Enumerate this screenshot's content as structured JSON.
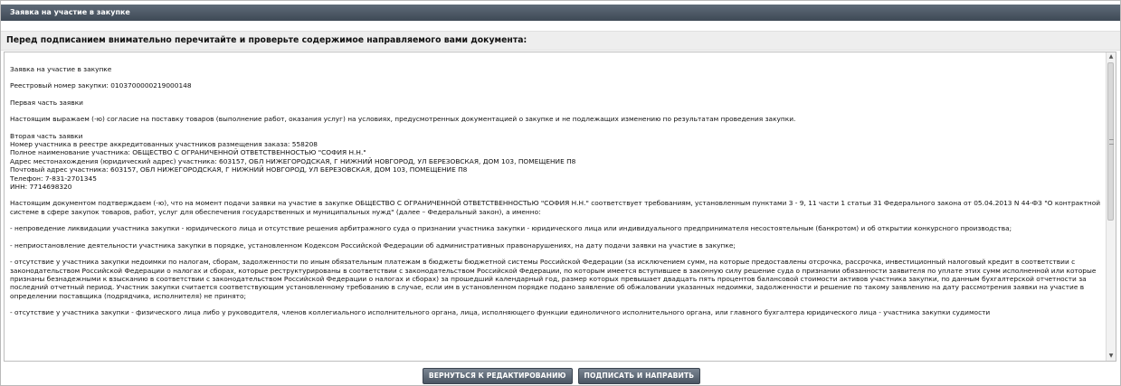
{
  "window": {
    "title": "Заявка на участие в закупке"
  },
  "instruction": "Перед подписанием внимательно перечитайте и проверьте содержимое направляемого вами документа:",
  "document": {
    "heading": "Заявка на участие в закупке",
    "registry_number": "Реестровый номер закупки: 0103700000219000148",
    "part1_title": "Первая часть заявки",
    "part1_text": "Настоящим выражаем (-ю) согласие на поставку товаров (выполнение работ, оказания услуг) на условиях, предусмотренных документацией о закупке и не подлежащих изменению по результатам проведения закупки.",
    "part2_title": "Вторая часть заявки",
    "participant_number": "Номер участника в реестре аккредитованных участников размещения заказа: 558208",
    "full_name": "Полное наименование участника: ОБЩЕСТВО С ОГРАНИЧЕННОЙ ОТВЕТСТВЕННОСТЬЮ \"СОФИЯ Н.Н.\"",
    "legal_address": "Адрес местонахождения (юридический адрес) участника: 603157, ОБЛ НИЖЕГОРОДСКАЯ, Г НИЖНИЙ НОВГОРОД, УЛ БЕРЕЗОВСКАЯ, ДОМ 103, ПОМЕЩЕНИЕ П8",
    "postal_address": "Почтовый адрес участника: 603157, ОБЛ НИЖЕГОРОДСКАЯ, Г НИЖНИЙ НОВГОРОД, УЛ БЕРЕЗОВСКАЯ, ДОМ 103, ПОМЕЩЕНИЕ П8",
    "phone": "Телефон: 7-831-2701345",
    "inn": "ИНН: 7714698320",
    "confirm_text": "Настоящим документом подтверждаем (-ю), что на момент подачи заявки на участие в закупке ОБЩЕСТВО С ОГРАНИЧЕННОЙ ОТВЕТСТВЕННОСТЬЮ \"СОФИЯ Н.Н.\" соответствует требованиям, установленным пунктами 3 - 9, 11 части 1 статьи 31 Федерального закона от 05.04.2013 N 44-ФЗ \"О контрактной системе в сфере закупок товаров, работ, услуг для обеспечения государственных и муниципальных нужд\" (далее – Федеральный закон), а именно:",
    "item1": "- непроведение ликвидации участника закупки - юридического лица и отсутствие решения арбитражного суда о признании участника закупки - юридического лица или индивидуального предпринимателя несостоятельным (банкротом) и об открытии конкурсного производства;",
    "item2": "- неприостановление деятельности участника закупки в порядке, установленном Кодексом Российской Федерации об административных правонарушениях, на дату подачи заявки на участие в закупке;",
    "item3": "- отсутствие у участника закупки недоимки по налогам, сборам, задолженности по иным обязательным платежам в бюджеты бюджетной системы Российской Федерации (за исключением сумм, на которые предоставлены отсрочка, рассрочка, инвестиционный налоговый кредит в соответствии с законодательством Российской Федерации о налогах и сборах, которые реструктурированы в соответствии с законодательством Российской Федерации, по которым имеется вступившее в законную силу решение суда о признании обязанности заявителя по уплате этих сумм исполненной или которые признаны безнадежными к взысканию в соответствии с законодательством Российской Федерации о налогах и сборах) за прошедший календарный год, размер которых превышает двадцать пять процентов балансовой стоимости активов участника закупки, по данным бухгалтерской отчетности за последний отчетный период. Участник закупки считается соответствующим установленному требованию в случае, если им в установленном порядке подано заявление об обжаловании указанных недоимки, задолженности и решение по такому заявлению на дату рассмотрения заявки на участие в определении поставщика (подрядчика, исполнителя) не принято;",
    "item4": "- отсутствие у участника закупки - физического лица либо у руководителя, членов коллегиального исполнительного органа, лица, исполняющего функции единоличного исполнительного органа, или главного бухгалтера юридического лица - участника закупки судимости"
  },
  "scrollbar": {
    "up_glyph": "▲",
    "down_glyph": "▼",
    "position": 0.0
  },
  "buttons": {
    "back": "ВЕРНУТЬСЯ К РЕДАКТИРОВАНИЮ",
    "sign": "ПОДПИСАТЬ И НАПРАВИТЬ"
  },
  "colors": {
    "titlebar": "#4a5563",
    "button": "#5b6674"
  }
}
